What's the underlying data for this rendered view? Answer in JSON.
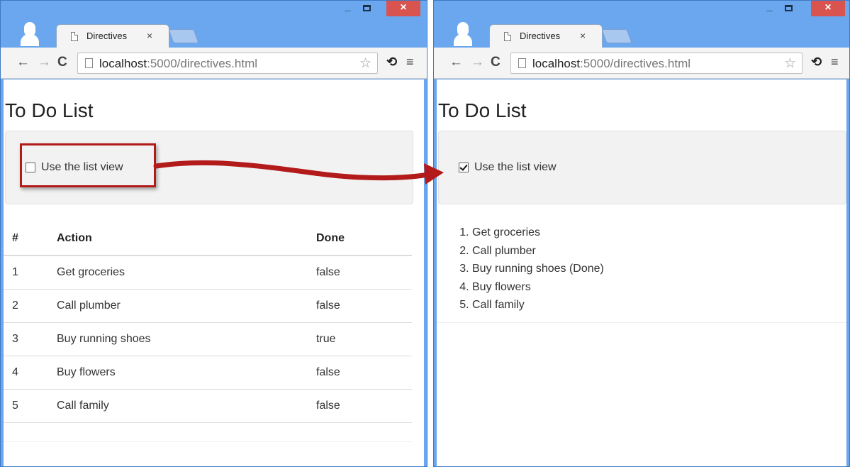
{
  "colors": {
    "window_frame": "#6aa7ee",
    "close_button": "#d9534f",
    "arrow": "#b31b1b",
    "well": "#f2f2f2"
  },
  "left_window": {
    "tab": {
      "title": "Directives",
      "close": "×"
    },
    "address": {
      "host": "localhost",
      "rest": ":5000/directives.html"
    },
    "page": {
      "title": "To Do List",
      "toggle": {
        "label": "Use the list view",
        "checked": false
      },
      "table": {
        "headers": [
          "#",
          "Action",
          "Done"
        ],
        "rows": [
          {
            "num": "1",
            "action": "Get groceries",
            "done": "false"
          },
          {
            "num": "2",
            "action": "Call plumber",
            "done": "false"
          },
          {
            "num": "3",
            "action": "Buy running shoes",
            "done": "true"
          },
          {
            "num": "4",
            "action": "Buy flowers",
            "done": "false"
          },
          {
            "num": "5",
            "action": "Call family",
            "done": "false"
          }
        ]
      }
    }
  },
  "right_window": {
    "tab": {
      "title": "Directives",
      "close": "×"
    },
    "address": {
      "host": "localhost",
      "rest": ":5000/directives.html"
    },
    "page": {
      "title": "To Do List",
      "toggle": {
        "label": "Use the list view",
        "checked": true
      },
      "list": [
        "Get groceries",
        "Call plumber",
        "Buy running shoes (Done)",
        "Buy flowers",
        "Call family"
      ]
    }
  },
  "icons": [
    "profile-icon",
    "page-icon",
    "back-arrow-icon",
    "forward-arrow-icon",
    "reload-icon",
    "star-icon",
    "extension-icon",
    "menu-icon",
    "minimize-icon",
    "maximize-icon",
    "close-icon",
    "annotation-arrow"
  ]
}
